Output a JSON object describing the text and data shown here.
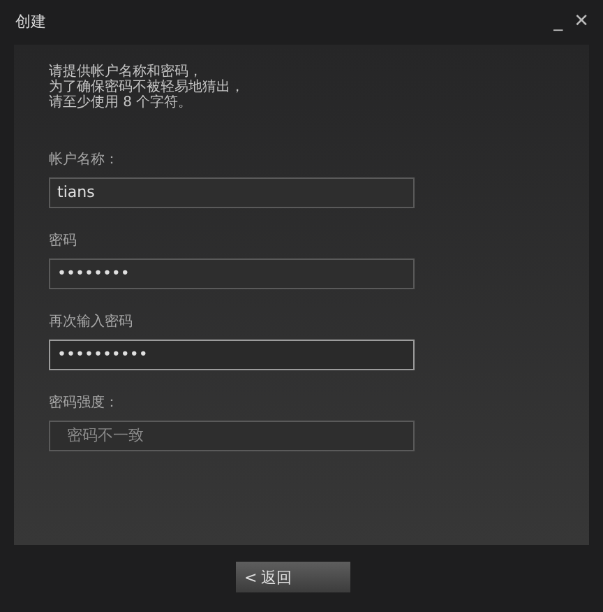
{
  "window": {
    "title": "创建",
    "controls": [
      "_",
      "✕"
    ]
  },
  "intro": [
    "请提供帐户名称和密码，",
    "为了确保密码不被轻易地猜出，",
    "请至少使用 8 个字符。"
  ],
  "fields": [
    {
      "label": "帐户名称：",
      "value": "tians",
      "focused": false,
      "disabled": false
    },
    {
      "label": "密码",
      "value": "••••••••",
      "focused": false,
      "disabled": false
    },
    {
      "label": "再次输入密码",
      "value": "••••••••••",
      "focused": true,
      "disabled": false
    },
    {
      "label": "密码强度：",
      "value": "密码不一致",
      "focused": false,
      "disabled": true
    }
  ],
  "buttons": [
    {
      "label": "返回",
      "kind": "back",
      "icon": "<"
    }
  ]
}
